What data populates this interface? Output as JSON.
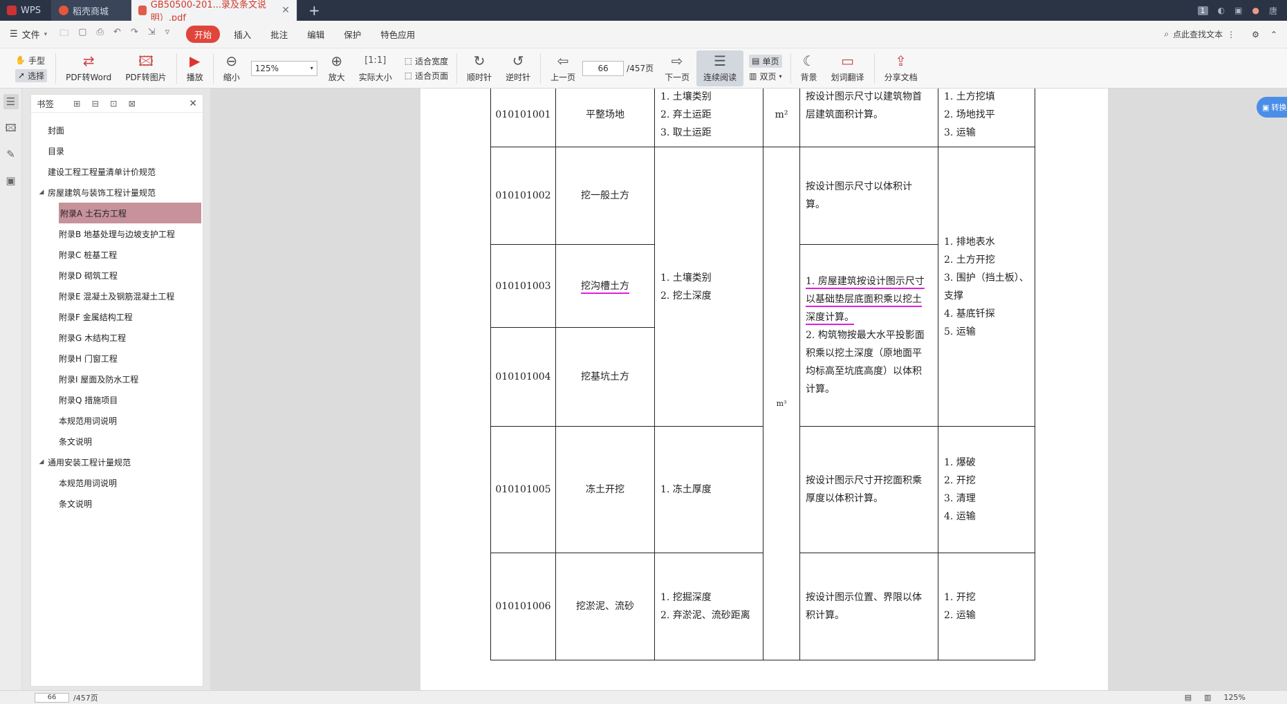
{
  "titlebar": {
    "tabs": [
      {
        "label": "WPS"
      },
      {
        "label": "稻壳商城"
      },
      {
        "label": "GB50500-201...录及条文说明）.pdf"
      }
    ],
    "page_badge": "1",
    "user": "唐"
  },
  "menubar": {
    "file": "文件",
    "menus": [
      "开始",
      "插入",
      "批注",
      "编辑",
      "保护",
      "特色应用"
    ],
    "search": "点此查找文本"
  },
  "ribbon": {
    "hand": "手型",
    "select": "选择",
    "pdf_to_word": "PDF转Word",
    "pdf_to_image": "PDF转图片",
    "play": "播放",
    "zoom_out": "缩小",
    "zoom_value": "125%",
    "zoom_in": "放大",
    "actual_size": "实际大小",
    "fit_width": "适合宽度",
    "fit_page": "适合页面",
    "rotate_cw": "顺时针",
    "rotate_ccw": "逆时针",
    "prev_page": "上一页",
    "page_current": "66",
    "page_total": "/457页",
    "next_page": "下一页",
    "continuous": "连续阅读",
    "single_page": "单页",
    "double_page": "双页",
    "background": "背景",
    "translate": "划词翻译",
    "share": "分享文档"
  },
  "bookmarks": {
    "title": "书签",
    "items": [
      {
        "label": "封面",
        "level": 1,
        "toggle": ""
      },
      {
        "label": "目录",
        "level": 1,
        "toggle": ""
      },
      {
        "label": "建设工程工程量清单计价规范",
        "level": 1,
        "toggle": ""
      },
      {
        "label": "房屋建筑与装饰工程计量规范",
        "level": 1,
        "toggle": "◢"
      },
      {
        "label": "附录A 土石方工程",
        "level": 2,
        "toggle": "",
        "selected": true
      },
      {
        "label": "附录B 地基处理与边坡支护工程",
        "level": 2,
        "toggle": ""
      },
      {
        "label": "附录C 桩基工程",
        "level": 2,
        "toggle": ""
      },
      {
        "label": "附录D 砌筑工程",
        "level": 2,
        "toggle": ""
      },
      {
        "label": "附录E 混凝土及钢筋混凝土工程",
        "level": 2,
        "toggle": ""
      },
      {
        "label": "附录F 金属结构工程",
        "level": 2,
        "toggle": ""
      },
      {
        "label": "附录G 木结构工程",
        "level": 2,
        "toggle": ""
      },
      {
        "label": "附录H 门窗工程",
        "level": 2,
        "toggle": ""
      },
      {
        "label": "附录I 屋面及防水工程",
        "level": 2,
        "toggle": ""
      },
      {
        "label": "附录Q 措施项目",
        "level": 2,
        "toggle": ""
      },
      {
        "label": "本规范用词说明",
        "level": 2,
        "toggle": ""
      },
      {
        "label": "条文说明",
        "level": 2,
        "toggle": ""
      },
      {
        "label": "通用安装工程计量规范",
        "level": 1,
        "toggle": "◢"
      },
      {
        "label": "本规范用词说明",
        "level": 2,
        "toggle": ""
      },
      {
        "label": "条文说明",
        "level": 2,
        "toggle": ""
      }
    ]
  },
  "convert_button": "转换",
  "table": {
    "rows": [
      {
        "code": "010101001",
        "name": "平整场地",
        "features": [
          "1. 土壤类别",
          "2. 弃土运距",
          "3. 取土运距"
        ],
        "unit": "m²",
        "rule": [
          "按设计图示尺寸以建筑物首",
          "层建筑面积计算。"
        ],
        "work": [
          "1. 土方挖填",
          "2. 场地找平",
          "3. 运输"
        ]
      },
      {
        "code": "010101002",
        "name": "挖一般土方",
        "rule": [
          "按设计图示尺寸以体积计",
          "算。"
        ]
      },
      {
        "code": "010101003",
        "name": "挖沟槽土方"
      },
      {
        "code": "010101004",
        "name": "挖基坑土方"
      },
      {
        "code": "010101005",
        "name": "冻土开挖",
        "features": [
          "1. 冻土厚度"
        ],
        "rule": [
          "按设计图示尺寸开挖面积乘",
          "厚度以体积计算。"
        ],
        "work": [
          "1. 爆破",
          "2. 开挖",
          "3. 清理",
          "4. 运输"
        ]
      },
      {
        "code": "010101006",
        "name": "挖淤泥、流砂",
        "features": [
          "1. 挖掘深度",
          "2. 弃淤泥、流砂距离"
        ],
        "rule": [
          "按设计图示位置、界限以体",
          "积计算。"
        ],
        "work": [
          "1. 开挖",
          "2. 运输"
        ]
      }
    ],
    "merged_features": [
      "1. 土壤类别",
      "2. 挖土深度"
    ],
    "merged_unit": "m³",
    "merged_rule": [
      "1. 房屋建筑按设计图示尺寸",
      "以基础垫层底面积乘以挖土",
      "深度计算。",
      "2. 构筑物按最大水平投影面",
      "积乘以挖土深度（原地面平",
      "均标高至坑底高度）以体积",
      "计算。"
    ],
    "merged_work": [
      "1. 排地表水",
      "2. 土方开挖",
      "3. 围护（挡土板）、",
      "支撑",
      "4. 基底钎探",
      "5. 运输"
    ]
  },
  "statusbar": {
    "page": "66",
    "total": "/457页",
    "zoom": "125%"
  }
}
